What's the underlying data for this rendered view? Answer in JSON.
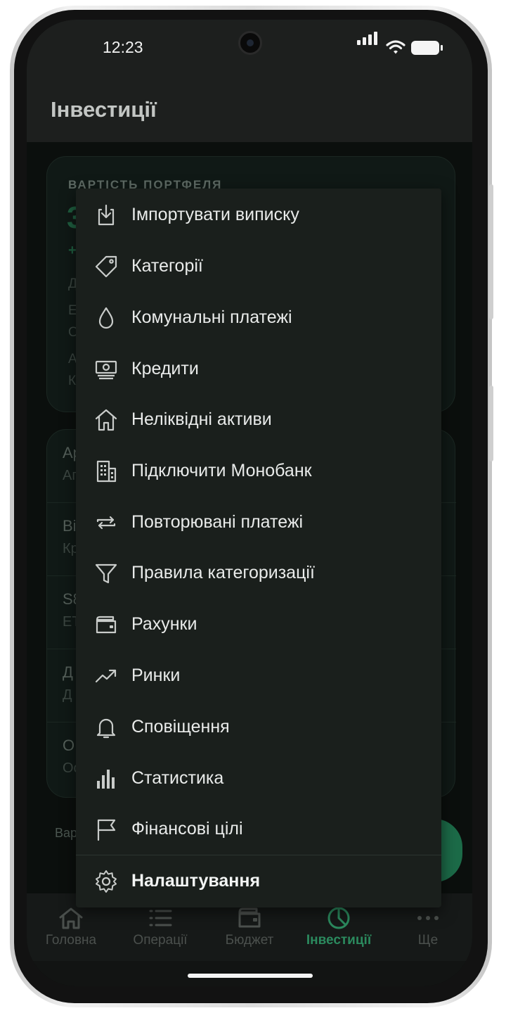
{
  "status_bar": {
    "time": "12:23"
  },
  "header": {
    "title": "Інвестиції"
  },
  "portfolio": {
    "label": "ВАРТІСТЬ ПОРТФЕЛЯ",
    "value_peek": "3",
    "change_peek": "+",
    "row_peeks": [
      "Д",
      "Е",
      "О",
      "А",
      "К"
    ]
  },
  "holdings": [
    {
      "name": "Ар",
      "sub": "Ап"
    },
    {
      "name": "Ві",
      "sub": "Кр"
    },
    {
      "name": "S8",
      "sub": "ЕТ"
    },
    {
      "name": "Д",
      "sub": "Д"
    },
    {
      "name": "О",
      "sub": "Ос"
    }
  ],
  "footer_peek": "Вар",
  "menu": {
    "items": [
      {
        "label": "Імпортувати виписку",
        "icon": "import-icon"
      },
      {
        "label": "Категорії",
        "icon": "tag-icon"
      },
      {
        "label": "Комунальні платежі",
        "icon": "drop-icon"
      },
      {
        "label": "Кредити",
        "icon": "money-icon"
      },
      {
        "label": "Неліквідні активи",
        "icon": "house-icon"
      },
      {
        "label": "Підключити Монобанк",
        "icon": "bank-icon"
      },
      {
        "label": "Повторювані платежі",
        "icon": "repeat-icon"
      },
      {
        "label": "Правила категоризації",
        "icon": "filter-icon"
      },
      {
        "label": "Рахунки",
        "icon": "wallet-icon"
      },
      {
        "label": "Ринки",
        "icon": "trend-icon"
      },
      {
        "label": "Сповіщення",
        "icon": "bell-icon"
      },
      {
        "label": "Статистика",
        "icon": "bar-chart-icon"
      },
      {
        "label": "Фінансові цілі",
        "icon": "flag-icon"
      }
    ],
    "settings": {
      "label": "Налаштування",
      "icon": "gear-icon"
    }
  },
  "bottom_nav": {
    "items": [
      {
        "label": "Головна",
        "icon": "home-icon"
      },
      {
        "label": "Операції",
        "icon": "list-icon"
      },
      {
        "label": "Бюджет",
        "icon": "wallet-icon"
      },
      {
        "label": "Інвестиції",
        "icon": "pie-chart-icon"
      },
      {
        "label": "Ще",
        "icon": "more-icon"
      }
    ],
    "active": "Інвестиції"
  },
  "colors": {
    "accent": "#2b8a5e",
    "menu_background": "#1a1f1c",
    "screen_background": "#0b0f0d",
    "header_background": "#1d1f1e"
  }
}
